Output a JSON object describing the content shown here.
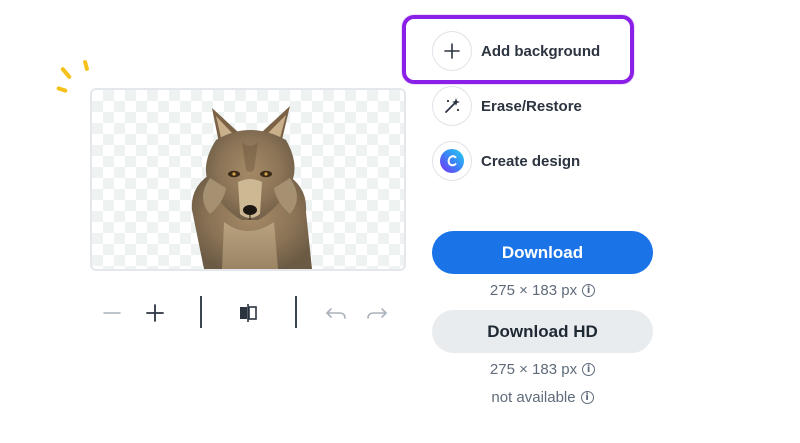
{
  "options": [
    {
      "label": "Add background",
      "icon": "plus-icon"
    },
    {
      "label": "Erase/Restore",
      "icon": "magic-wand-icon"
    },
    {
      "label": "Create design",
      "icon": "canva-logo-icon"
    }
  ],
  "download": {
    "label": "Download",
    "size": "275 × 183 px"
  },
  "download_hd": {
    "label": "Download HD",
    "size": "275 × 183 px",
    "status": "not available"
  },
  "toolbar": {
    "zoom_out_icon": "minus-icon",
    "zoom_in_icon": "plus-icon",
    "compare_icon": "compare-icon",
    "undo_icon": "undo-icon",
    "redo_icon": "redo-icon"
  },
  "colors": {
    "primary": "#1a74e8",
    "highlight": "#8a1fe8",
    "sparkle": "#f4c21b",
    "secondary_button": "#e9ecef"
  }
}
